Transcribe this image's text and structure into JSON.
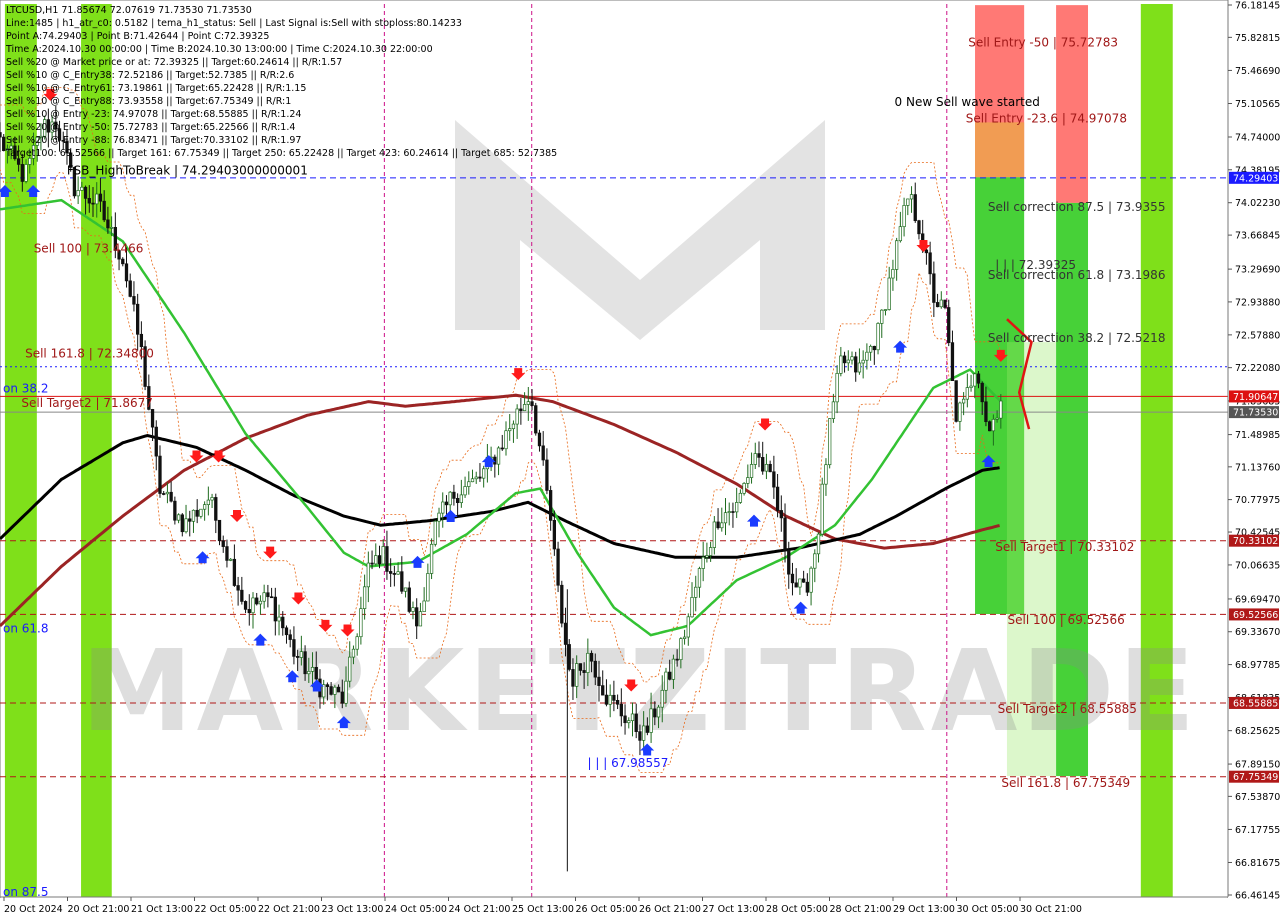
{
  "header": {
    "lines": [
      "LTCUSD,H1  71.85674 72.07619 71.73530 71.73530",
      "Line:1485  | h1_atr_c0: 0.5182  | tema_h1_status: Sell  | Last Signal is:Sell with stoploss:80.14233",
      "Point A:74.29403  | Point B:71.42644  | Point C:72.39325",
      "Time A:2024.10.30 00:00:00  | Time B:2024.10.30 13:00:00  | Time C:2024.10.30 22:00:00",
      "Sell %20 @ Market price or at: 72.39325  || Target:60.24614  || R/R:1.57",
      "Sell %10 @ C_Entry38: 72.52186  || Target:52.7385  || R/R:2.6",
      "Sell %10 @ C_Entry61: 73.19861  || Target:65.22428  || R/R:1.15",
      "Sell %10 @ C_Entry88: 73.93558  || Target:67.75349  || R/R:1",
      "Sell %10 @ Entry -23: 74.97078  || Target:68.55885  || R/R:1.24",
      "Sell %20 @ Entry -50: 75.72783  || Target:65.22566  || R/R:1.4",
      "Sell %20 @ Entry -88: 76.83471  || Target:70.33102  || R/R:1.97",
      "Target100: 69.52566  || Target 161: 67.75349  || Target 250: 65.22428  || Target 423: 60.24614  || Target 685: 52.7385"
    ]
  },
  "watermark": "MARKETZITRADE",
  "chart_data": {
    "type": "candlestick",
    "symbol": "LTCUSD",
    "timeframe": "H1",
    "ylim": [
      66.46145,
      76.18145
    ],
    "y_ticks": [
      "76.18145",
      "75.82815",
      "75.46690",
      "75.10565",
      "74.74000",
      "74.38195",
      "74.02230",
      "73.66845",
      "73.29690",
      "72.93880",
      "72.57880",
      "72.22080",
      "71.85685",
      "71.48985",
      "71.13760",
      "70.77975",
      "70.42545",
      "70.06635",
      "69.69470",
      "69.33670",
      "68.97785",
      "68.61835",
      "68.25625",
      "67.89150",
      "67.53870",
      "67.17755",
      "66.81675",
      "66.46145"
    ],
    "x_ticks": [
      "20 Oct 2024",
      "20 Oct 21:00",
      "21 Oct 13:00",
      "22 Oct 05:00",
      "22 Oct 21:00",
      "23 Oct 13:00",
      "24 Oct 05:00",
      "24 Oct 21:00",
      "25 Oct 13:00",
      "26 Oct 05:00",
      "26 Oct 21:00",
      "27 Oct 13:00",
      "28 Oct 05:00",
      "28 Oct 21:00",
      "29 Oct 13:00",
      "30 Oct 05:00",
      "30 Oct 21:00"
    ],
    "price_tags": [
      {
        "value": "74.29403",
        "price": 74.29403,
        "color": "#1a1aff"
      },
      {
        "value": "71.90647",
        "price": 71.90647,
        "color": "#dd1111"
      },
      {
        "value": "71.73530",
        "price": 71.7353,
        "color": "#555555"
      },
      {
        "value": "70.33102",
        "price": 70.33102,
        "color": "#b01818"
      },
      {
        "value": "69.52566",
        "price": 69.52566,
        "color": "#b01818"
      },
      {
        "value": "68.55885",
        "price": 68.55885,
        "color": "#b01818"
      },
      {
        "value": "67.75349",
        "price": 67.75349,
        "color": "#b01818"
      }
    ],
    "hlines": [
      {
        "price": 74.29403,
        "color": "#1a1aff",
        "style": "dashed",
        "x_from": 0.0
      },
      {
        "price": 72.23,
        "color": "#1a1aff",
        "style": "dotted",
        "x_from": 0.0
      },
      {
        "price": 71.90647,
        "color": "#dd1111",
        "style": "solid",
        "x_from": 0.0
      },
      {
        "price": 71.7353,
        "color": "#888888",
        "style": "solid",
        "x_from": 0.0
      },
      {
        "price": 70.33102,
        "color": "#b01818",
        "style": "dashed",
        "x_from": 0.0
      },
      {
        "price": 69.52566,
        "color": "#b01818",
        "style": "dashed",
        "x_from": 0.0
      },
      {
        "price": 68.55885,
        "color": "#b01818",
        "style": "dashed",
        "x_from": 0.0
      },
      {
        "price": 67.75349,
        "color": "#b01818",
        "style": "dashed",
        "x_from": 0.0
      }
    ],
    "vlines": [
      0.313,
      0.433,
      0.771
    ],
    "green_columns": [
      [
        0.004,
        0.03
      ],
      [
        0.066,
        0.091
      ],
      [
        0.929,
        0.955
      ]
    ],
    "zones": [
      {
        "x": [
          0.794,
          0.834
        ],
        "from": 76.18,
        "to": 74.3,
        "color": "#ff6a66"
      },
      {
        "x": [
          0.794,
          0.834
        ],
        "from": 74.9,
        "to": 74.3,
        "color": "#f0a050"
      },
      {
        "x": [
          0.794,
          0.834
        ],
        "from": 74.3,
        "to": 69.53,
        "color": "#33cc22"
      },
      {
        "x": [
          0.86,
          0.886
        ],
        "from": 76.18,
        "to": 74.02,
        "color": "#ff6a66"
      },
      {
        "x": [
          0.86,
          0.886
        ],
        "from": 74.02,
        "to": 67.76,
        "color": "#33cc22"
      }
    ],
    "labels": [
      {
        "text": "Sell Entry -50 | 75.72783",
        "price": 75.72783,
        "x": 0.786,
        "color": "#a01818"
      },
      {
        "text": "0 New Sell wave started",
        "price": 75.08,
        "x": 0.726,
        "color": "#000000"
      },
      {
        "text": "Sell Entry -23.6 | 74.97078",
        "price": 74.9,
        "x": 0.784,
        "color": "#a01818"
      },
      {
        "text": "Sell correction 87.5 | 73.9355",
        "price": 73.93,
        "x": 0.802,
        "color": "#333333"
      },
      {
        "text": "| | | 72.39325",
        "price": 73.3,
        "x": 0.808,
        "color": "#333333"
      },
      {
        "text": "Sell correction 61.8 | 73.1986",
        "price": 73.19,
        "x": 0.802,
        "color": "#333333"
      },
      {
        "text": "Sell correction 38.2 | 72.5218",
        "price": 72.5,
        "x": 0.802,
        "color": "#333333"
      },
      {
        "text": "Sell 100 | 73.4466",
        "price": 73.48,
        "x": 0.025,
        "color": "#a01818"
      },
      {
        "text": "Sell 161.8 | 72.34800",
        "price": 72.33,
        "x": 0.018,
        "color": "#a01818"
      },
      {
        "text": "Sell Target2 | 71.8677",
        "price": 71.79,
        "x": 0.015,
        "color": "#a01818"
      },
      {
        "text": "on 38.2",
        "price": 71.95,
        "x": 0.0,
        "color": "#1a1aff"
      },
      {
        "text": "on 61.8",
        "price": 69.33,
        "x": 0.0,
        "color": "#1a1aff"
      },
      {
        "text": "on 87.5",
        "price": 66.45,
        "x": 0.0,
        "color": "#1a1aff"
      },
      {
        "text": "| | | 67.98557",
        "price": 67.86,
        "x": 0.476,
        "color": "#1a1aff"
      },
      {
        "text": "FSB_HighToBreak  |  74.29403000000001",
        "price": 74.33,
        "x": 0.052,
        "color": "#000000"
      },
      {
        "text": "Sell Target1 | 70.33102",
        "price": 70.22,
        "x": 0.808,
        "color": "#a01818"
      },
      {
        "text": "Sell 100 | 69.52566",
        "price": 69.42,
        "x": 0.818,
        "color": "#a01818"
      },
      {
        "text": "Sell Target2 | 68.55885",
        "price": 68.45,
        "x": 0.81,
        "color": "#a01818"
      },
      {
        "text": "Sell 161.8 | 67.75349",
        "price": 67.64,
        "x": 0.813,
        "color": "#a01818"
      }
    ],
    "anchors": [
      {
        "t": 0.0,
        "p": 74.7
      },
      {
        "t": 0.02,
        "p": 74.3
      },
      {
        "t": 0.035,
        "p": 74.85
      },
      {
        "t": 0.046,
        "p": 74.9
      },
      {
        "t": 0.06,
        "p": 74.2
      },
      {
        "t": 0.08,
        "p": 74.0
      },
      {
        "t": 0.1,
        "p": 73.4
      },
      {
        "t": 0.115,
        "p": 72.4
      },
      {
        "t": 0.13,
        "p": 70.9
      },
      {
        "t": 0.15,
        "p": 70.5
      },
      {
        "t": 0.17,
        "p": 70.8
      },
      {
        "t": 0.185,
        "p": 70.2
      },
      {
        "t": 0.2,
        "p": 69.6
      },
      {
        "t": 0.22,
        "p": 69.7
      },
      {
        "t": 0.24,
        "p": 69.1
      },
      {
        "t": 0.26,
        "p": 68.75
      },
      {
        "t": 0.28,
        "p": 68.6
      },
      {
        "t": 0.29,
        "p": 69.3
      },
      {
        "t": 0.3,
        "p": 70.0
      },
      {
        "t": 0.31,
        "p": 70.2
      },
      {
        "t": 0.325,
        "p": 69.9
      },
      {
        "t": 0.34,
        "p": 69.4
      },
      {
        "t": 0.355,
        "p": 70.5
      },
      {
        "t": 0.37,
        "p": 70.85
      },
      {
        "t": 0.39,
        "p": 71.0
      },
      {
        "t": 0.405,
        "p": 71.3
      },
      {
        "t": 0.42,
        "p": 71.7
      },
      {
        "t": 0.432,
        "p": 71.95
      },
      {
        "t": 0.44,
        "p": 71.3
      },
      {
        "t": 0.448,
        "p": 70.6
      },
      {
        "t": 0.455,
        "p": 69.7
      },
      {
        "t": 0.465,
        "p": 68.8
      },
      {
        "t": 0.48,
        "p": 69.1
      },
      {
        "t": 0.495,
        "p": 68.6
      },
      {
        "t": 0.51,
        "p": 68.4
      },
      {
        "t": 0.525,
        "p": 68.2
      },
      {
        "t": 0.54,
        "p": 68.7
      },
      {
        "t": 0.555,
        "p": 69.2
      },
      {
        "t": 0.57,
        "p": 70.0
      },
      {
        "t": 0.585,
        "p": 70.6
      },
      {
        "t": 0.6,
        "p": 70.7
      },
      {
        "t": 0.615,
        "p": 71.3
      },
      {
        "t": 0.63,
        "p": 70.9
      },
      {
        "t": 0.645,
        "p": 69.9
      },
      {
        "t": 0.655,
        "p": 69.75
      },
      {
        "t": 0.665,
        "p": 70.3
      },
      {
        "t": 0.675,
        "p": 71.5
      },
      {
        "t": 0.685,
        "p": 72.3
      },
      {
        "t": 0.7,
        "p": 72.2
      },
      {
        "t": 0.715,
        "p": 72.6
      },
      {
        "t": 0.728,
        "p": 73.4
      },
      {
        "t": 0.74,
        "p": 74.1
      },
      {
        "t": 0.748,
        "p": 73.8
      },
      {
        "t": 0.76,
        "p": 73.0
      },
      {
        "t": 0.77,
        "p": 72.8
      },
      {
        "t": 0.778,
        "p": 71.7
      },
      {
        "t": 0.785,
        "p": 71.8
      },
      {
        "t": 0.795,
        "p": 72.3
      },
      {
        "t": 0.805,
        "p": 71.5
      },
      {
        "t": 0.815,
        "p": 71.9
      }
    ],
    "ema_green": [
      {
        "t": 0.0,
        "p": 73.95
      },
      {
        "t": 0.05,
        "p": 74.05
      },
      {
        "t": 0.1,
        "p": 73.6
      },
      {
        "t": 0.15,
        "p": 72.6
      },
      {
        "t": 0.2,
        "p": 71.5
      },
      {
        "t": 0.25,
        "p": 70.7
      },
      {
        "t": 0.28,
        "p": 70.2
      },
      {
        "t": 0.3,
        "p": 70.05
      },
      {
        "t": 0.34,
        "p": 70.1
      },
      {
        "t": 0.38,
        "p": 70.4
      },
      {
        "t": 0.42,
        "p": 70.85
      },
      {
        "t": 0.44,
        "p": 70.9
      },
      {
        "t": 0.47,
        "p": 70.2
      },
      {
        "t": 0.5,
        "p": 69.6
      },
      {
        "t": 0.53,
        "p": 69.3
      },
      {
        "t": 0.56,
        "p": 69.4
      },
      {
        "t": 0.6,
        "p": 69.9
      },
      {
        "t": 0.64,
        "p": 70.15
      },
      {
        "t": 0.68,
        "p": 70.5
      },
      {
        "t": 0.71,
        "p": 71.0
      },
      {
        "t": 0.74,
        "p": 71.6
      },
      {
        "t": 0.76,
        "p": 72.0
      },
      {
        "t": 0.79,
        "p": 72.2
      },
      {
        "t": 0.815,
        "p": 71.85
      }
    ],
    "ma_black": [
      {
        "t": 0.0,
        "p": 70.35
      },
      {
        "t": 0.05,
        "p": 71.0
      },
      {
        "t": 0.1,
        "p": 71.4
      },
      {
        "t": 0.12,
        "p": 71.48
      },
      {
        "t": 0.16,
        "p": 71.35
      },
      {
        "t": 0.2,
        "p": 71.1
      },
      {
        "t": 0.24,
        "p": 70.82
      },
      {
        "t": 0.28,
        "p": 70.6
      },
      {
        "t": 0.31,
        "p": 70.5
      },
      {
        "t": 0.35,
        "p": 70.55
      },
      {
        "t": 0.4,
        "p": 70.65
      },
      {
        "t": 0.43,
        "p": 70.75
      },
      {
        "t": 0.46,
        "p": 70.55
      },
      {
        "t": 0.5,
        "p": 70.3
      },
      {
        "t": 0.55,
        "p": 70.15
      },
      {
        "t": 0.6,
        "p": 70.15
      },
      {
        "t": 0.65,
        "p": 70.25
      },
      {
        "t": 0.7,
        "p": 70.4
      },
      {
        "t": 0.73,
        "p": 70.6
      },
      {
        "t": 0.77,
        "p": 70.9
      },
      {
        "t": 0.8,
        "p": 71.1
      },
      {
        "t": 0.815,
        "p": 71.13
      }
    ],
    "ma_darkred": [
      {
        "t": 0.0,
        "p": 69.4
      },
      {
        "t": 0.05,
        "p": 70.05
      },
      {
        "t": 0.1,
        "p": 70.6
      },
      {
        "t": 0.15,
        "p": 71.1
      },
      {
        "t": 0.2,
        "p": 71.45
      },
      {
        "t": 0.25,
        "p": 71.7
      },
      {
        "t": 0.3,
        "p": 71.85
      },
      {
        "t": 0.33,
        "p": 71.8
      },
      {
        "t": 0.37,
        "p": 71.85
      },
      {
        "t": 0.42,
        "p": 71.92
      },
      {
        "t": 0.45,
        "p": 71.85
      },
      {
        "t": 0.5,
        "p": 71.6
      },
      {
        "t": 0.55,
        "p": 71.3
      },
      {
        "t": 0.6,
        "p": 70.95
      },
      {
        "t": 0.64,
        "p": 70.6
      },
      {
        "t": 0.68,
        "p": 70.35
      },
      {
        "t": 0.72,
        "p": 70.25
      },
      {
        "t": 0.76,
        "p": 70.3
      },
      {
        "t": 0.8,
        "p": 70.45
      },
      {
        "t": 0.815,
        "p": 70.5
      }
    ],
    "sell_arrows": [
      {
        "t": 0.041,
        "p": 75.2
      },
      {
        "t": 0.16,
        "p": 71.25
      },
      {
        "t": 0.178,
        "p": 71.25
      },
      {
        "t": 0.193,
        "p": 70.6
      },
      {
        "t": 0.22,
        "p": 70.2
      },
      {
        "t": 0.243,
        "p": 69.7
      },
      {
        "t": 0.265,
        "p": 69.4
      },
      {
        "t": 0.283,
        "p": 69.35
      },
      {
        "t": 0.422,
        "p": 72.15
      },
      {
        "t": 0.514,
        "p": 68.75
      },
      {
        "t": 0.623,
        "p": 71.6
      },
      {
        "t": 0.752,
        "p": 73.55
      },
      {
        "t": 0.815,
        "p": 72.35
      }
    ],
    "buy_arrows": [
      {
        "t": 0.004,
        "p": 74.15
      },
      {
        "t": 0.027,
        "p": 74.15
      },
      {
        "t": 0.165,
        "p": 70.15
      },
      {
        "t": 0.212,
        "p": 69.25
      },
      {
        "t": 0.238,
        "p": 68.85
      },
      {
        "t": 0.258,
        "p": 68.75
      },
      {
        "t": 0.28,
        "p": 68.35
      },
      {
        "t": 0.34,
        "p": 70.1
      },
      {
        "t": 0.367,
        "p": 70.6
      },
      {
        "t": 0.398,
        "p": 71.2
      },
      {
        "t": 0.527,
        "p": 68.05
      },
      {
        "t": 0.614,
        "p": 70.55
      },
      {
        "t": 0.652,
        "p": 69.6
      },
      {
        "t": 0.733,
        "p": 72.45
      },
      {
        "t": 0.805,
        "p": 71.2
      }
    ]
  }
}
